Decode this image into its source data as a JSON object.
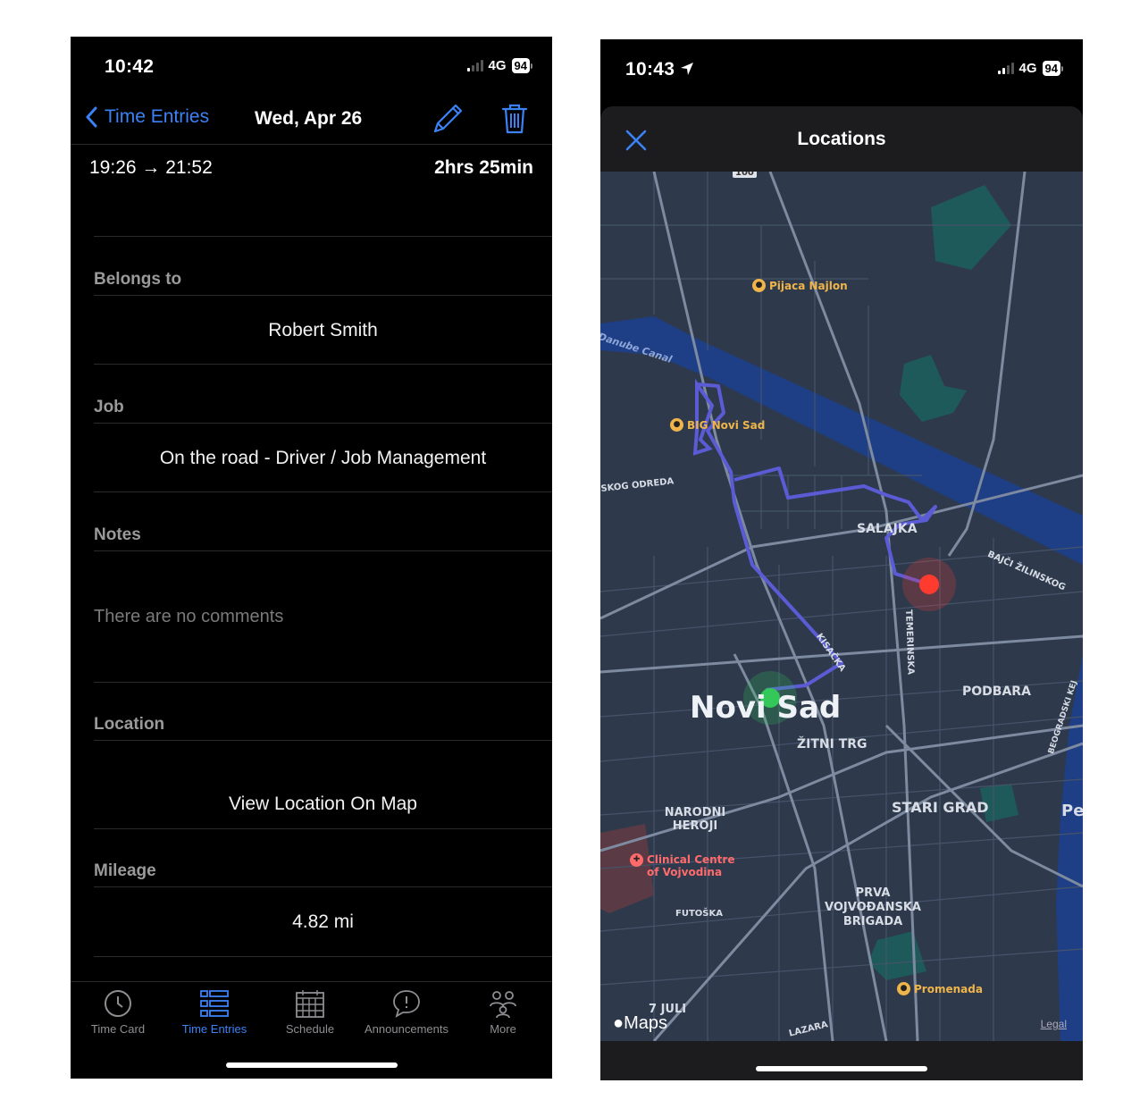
{
  "left": {
    "status": {
      "time": "10:42",
      "network": "4G",
      "battery": "94"
    },
    "nav": {
      "back_label": "Time Entries",
      "title": "Wed, Apr 26",
      "edit_icon": "pencil-icon",
      "delete_icon": "trash-icon"
    },
    "entry": {
      "time_range": "19:26 → 21:52",
      "duration": "2hrs 25min"
    },
    "sections": {
      "belongs_to": {
        "label": "Belongs to",
        "value": "Robert Smith"
      },
      "job": {
        "label": "Job",
        "value": "On the road - Driver / Job Management"
      },
      "notes": {
        "label": "Notes",
        "placeholder": "There are no comments"
      },
      "location": {
        "label": "Location",
        "link": "View Location On Map"
      },
      "mileage": {
        "label": "Mileage",
        "value": "4.82 mi"
      }
    },
    "tabs": [
      {
        "label": "Time Card",
        "icon": "clock-icon"
      },
      {
        "label": "Time Entries",
        "icon": "list-icon",
        "active": true
      },
      {
        "label": "Schedule",
        "icon": "calendar-icon"
      },
      {
        "label": "Announcements",
        "icon": "speech-bubble-icon"
      },
      {
        "label": "More",
        "icon": "people-icon"
      }
    ]
  },
  "right": {
    "status": {
      "time": "10:43",
      "network": "4G",
      "battery": "94"
    },
    "sheet": {
      "title": "Locations",
      "close_icon": "close-icon"
    },
    "map": {
      "city": "Novi Sad",
      "districts": [
        "SALAJKA",
        "PODBARA",
        "ŽITNI TRG",
        "NARODNI HEROJI",
        "STARI GRAD",
        "PRVA VOJVOĐANSKA BRIGADA",
        "7 JULI"
      ],
      "streets": [
        "Danube Canal",
        "SKOG ODREDA",
        "BAJČI ŽILINSKOG",
        "TEMERINSKA",
        "KISAČKA",
        "FUTOŠKA",
        "BEOGRADSKI KEJ",
        "LAZARA",
        "100"
      ],
      "pois": [
        "Pijaca Najlon",
        "BIG Novi Sad",
        "Clinical Centre of Vojvodina",
        "Promenada"
      ],
      "edge_text": "Pe",
      "brand": "Maps",
      "legal": "Legal",
      "route_color": "#5b5bd6",
      "start_color": "#34c759",
      "end_color": "#ff3b30"
    }
  }
}
